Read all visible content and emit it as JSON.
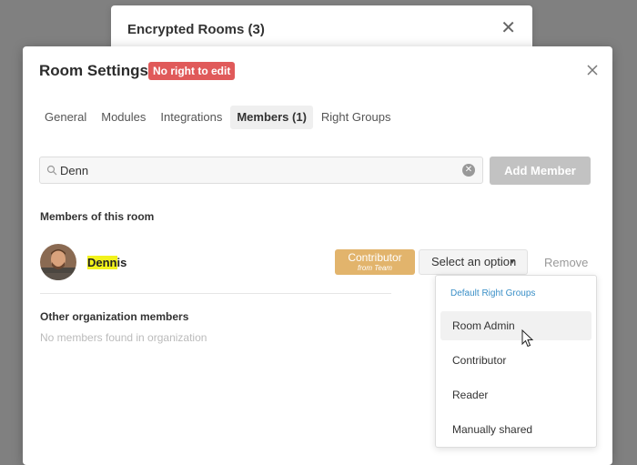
{
  "background_dialog": {
    "title": "Encrypted Rooms (3)",
    "close_glyph": "✕"
  },
  "dialog": {
    "title": "Room Settings",
    "badge": "No right to edit",
    "badge_color": "#e05a5a",
    "tabs": [
      {
        "label": "General"
      },
      {
        "label": "Modules"
      },
      {
        "label": "Integrations"
      },
      {
        "label": "Members (1)",
        "active": true
      },
      {
        "label": "Right Groups"
      }
    ]
  },
  "search": {
    "value": "Denn",
    "add_button": "Add Member"
  },
  "members": {
    "heading": "Members of this room",
    "items": [
      {
        "name_match": "Denn",
        "name_rest": "is",
        "role_badge": "Contributor",
        "role_source": "from Team",
        "role_badge_color": "#e2b46c",
        "select_label": "Select an option",
        "remove_label": "Remove"
      }
    ]
  },
  "other": {
    "heading": "Other organization members",
    "empty_text": "No members found in organization"
  },
  "dropdown": {
    "header": "Default Right Groups",
    "options": [
      "Room Admin",
      "Contributor",
      "Reader",
      "Manually shared"
    ],
    "hovered_option": "Room Admin"
  }
}
